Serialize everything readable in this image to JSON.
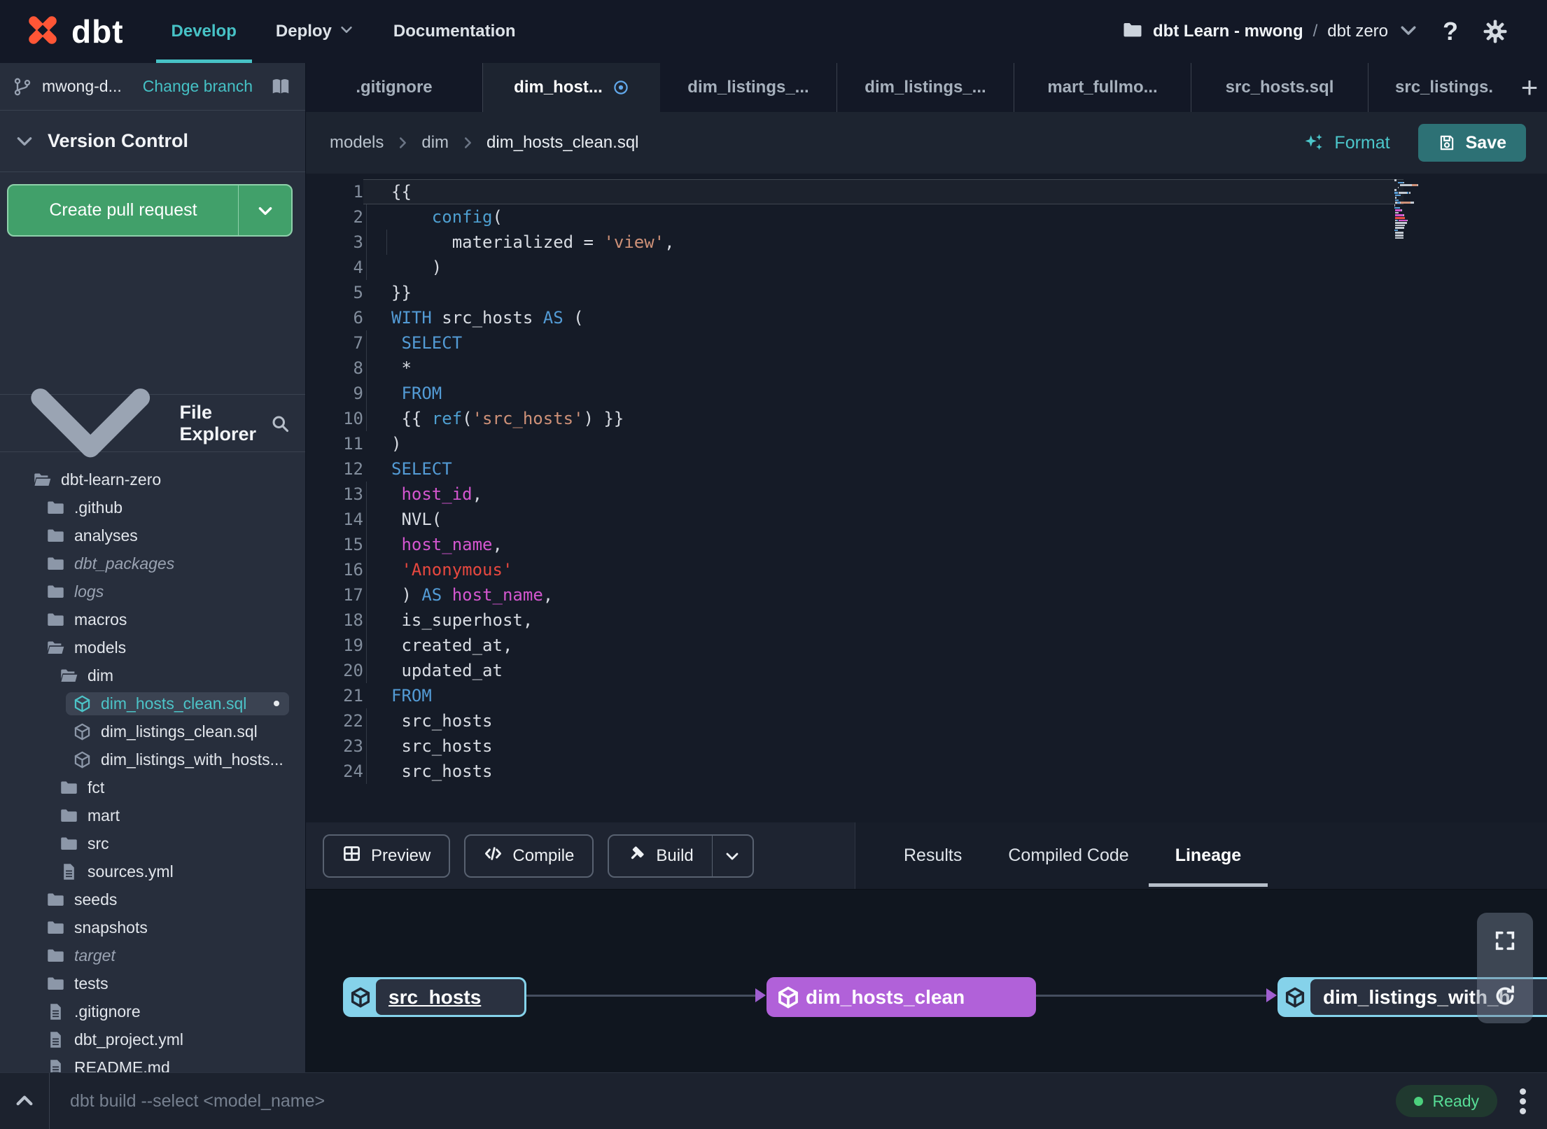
{
  "topbar": {
    "logo_text": "dbt",
    "nav": [
      {
        "label": "Develop",
        "active": true,
        "has_chevron": false
      },
      {
        "label": "Deploy",
        "active": false,
        "has_chevron": true
      },
      {
        "label": "Documentation",
        "active": false,
        "has_chevron": false
      }
    ],
    "account": "dbt Learn - mwong",
    "separator": "/",
    "project": "dbt zero"
  },
  "icons": {
    "help_glyph": "?",
    "plus_glyph": "+"
  },
  "sidebar": {
    "branch": {
      "name": "mwong-d...",
      "change_label": "Change branch"
    },
    "version_control_label": "Version Control",
    "create_pr_label": "Create pull request",
    "file_explorer_label": "File Explorer",
    "tree": [
      {
        "label": "dbt-learn-zero",
        "type": "folder-open",
        "level": 0
      },
      {
        "label": ".github",
        "type": "folder",
        "level": 1
      },
      {
        "label": "analyses",
        "type": "folder",
        "level": 1
      },
      {
        "label": "dbt_packages",
        "type": "folder",
        "level": 1,
        "italic": true
      },
      {
        "label": "logs",
        "type": "folder",
        "level": 1,
        "italic": true
      },
      {
        "label": "macros",
        "type": "folder",
        "level": 1
      },
      {
        "label": "models",
        "type": "folder-open",
        "level": 1
      },
      {
        "label": "dim",
        "type": "folder-open",
        "level": 2
      },
      {
        "label": "dim_hosts_clean.sql",
        "type": "model",
        "level": 3,
        "selected": true,
        "modified": true
      },
      {
        "label": "dim_listings_clean.sql",
        "type": "model",
        "level": 3
      },
      {
        "label": "dim_listings_with_hosts...",
        "type": "model",
        "level": 3
      },
      {
        "label": "fct",
        "type": "folder",
        "level": 2
      },
      {
        "label": "mart",
        "type": "folder",
        "level": 2
      },
      {
        "label": "src",
        "type": "folder",
        "level": 2
      },
      {
        "label": "sources.yml",
        "type": "file",
        "level": 2
      },
      {
        "label": "seeds",
        "type": "folder",
        "level": 1
      },
      {
        "label": "snapshots",
        "type": "folder",
        "level": 1
      },
      {
        "label": "target",
        "type": "folder",
        "level": 1,
        "italic": true
      },
      {
        "label": "tests",
        "type": "folder",
        "level": 1
      },
      {
        "label": ".gitignore",
        "type": "file",
        "level": 1
      },
      {
        "label": "dbt_project.yml",
        "type": "file",
        "level": 1
      },
      {
        "label": "README.md",
        "type": "file",
        "level": 1
      }
    ]
  },
  "tabs": {
    "items": [
      {
        "label": ".gitignore",
        "active": false,
        "dirty": false
      },
      {
        "label": "dim_host...",
        "active": true,
        "dirty": true
      },
      {
        "label": "dim_listings_...",
        "active": false,
        "dirty": false
      },
      {
        "label": "dim_listings_...",
        "active": false,
        "dirty": false
      },
      {
        "label": "mart_fullmo...",
        "active": false,
        "dirty": false
      },
      {
        "label": "src_hosts.sql",
        "active": false,
        "dirty": false
      },
      {
        "label": "src_listings.",
        "active": false,
        "dirty": false
      }
    ]
  },
  "editor_header": {
    "breadcrumb": [
      "models",
      "dim",
      "dim_hosts_clean.sql"
    ],
    "format_label": "Format",
    "save_label": "Save"
  },
  "editor": {
    "lines": [
      {
        "n": 1,
        "cur": true,
        "g": 0,
        "t": [
          [
            "p",
            "{{"
          ]
        ]
      },
      {
        "n": 2,
        "cur": false,
        "g": 1,
        "t": [
          [
            "p",
            "    "
          ],
          [
            "f",
            "config"
          ],
          [
            "p",
            "("
          ]
        ]
      },
      {
        "n": 3,
        "cur": false,
        "g": 2,
        "t": [
          [
            "p",
            "      materialized = "
          ],
          [
            "s",
            "'view'"
          ],
          [
            "p",
            ","
          ]
        ]
      },
      {
        "n": 4,
        "cur": false,
        "g": 1,
        "t": [
          [
            "p",
            "    )"
          ]
        ]
      },
      {
        "n": 5,
        "cur": false,
        "g": 0,
        "t": [
          [
            "p",
            "}}"
          ]
        ]
      },
      {
        "n": 6,
        "cur": false,
        "g": 0,
        "t": [
          [
            "k",
            "WITH"
          ],
          [
            "p",
            " src_hosts "
          ],
          [
            "k",
            "AS"
          ],
          [
            "p",
            " ("
          ]
        ]
      },
      {
        "n": 7,
        "cur": false,
        "g": 1,
        "t": [
          [
            "p",
            " "
          ],
          [
            "k",
            "SELECT"
          ]
        ]
      },
      {
        "n": 8,
        "cur": false,
        "g": 1,
        "t": [
          [
            "p",
            " *"
          ]
        ]
      },
      {
        "n": 9,
        "cur": false,
        "g": 1,
        "t": [
          [
            "p",
            " "
          ],
          [
            "k",
            "FROM"
          ]
        ]
      },
      {
        "n": 10,
        "cur": false,
        "g": 1,
        "t": [
          [
            "p",
            " {{ "
          ],
          [
            "f",
            "ref"
          ],
          [
            "p",
            "("
          ],
          [
            "s",
            "'src_hosts'"
          ],
          [
            "p",
            ") }}"
          ]
        ]
      },
      {
        "n": 11,
        "cur": false,
        "g": 0,
        "t": [
          [
            "p",
            ")"
          ]
        ]
      },
      {
        "n": 12,
        "cur": false,
        "g": 0,
        "t": [
          [
            "k",
            "SELECT"
          ]
        ]
      },
      {
        "n": 13,
        "cur": false,
        "g": 1,
        "t": [
          [
            "p",
            " "
          ],
          [
            "m",
            "host_id"
          ],
          [
            "p",
            ","
          ]
        ]
      },
      {
        "n": 14,
        "cur": false,
        "g": 1,
        "t": [
          [
            "p",
            " NVL("
          ]
        ]
      },
      {
        "n": 15,
        "cur": false,
        "g": 1,
        "t": [
          [
            "p",
            " "
          ],
          [
            "m",
            "host_name"
          ],
          [
            "p",
            ","
          ]
        ]
      },
      {
        "n": 16,
        "cur": false,
        "g": 1,
        "t": [
          [
            "p",
            " "
          ],
          [
            "r",
            "'Anonymous'"
          ]
        ]
      },
      {
        "n": 17,
        "cur": false,
        "g": 1,
        "t": [
          [
            "p",
            " ) "
          ],
          [
            "k",
            "AS"
          ],
          [
            "p",
            " "
          ],
          [
            "m",
            "host_name"
          ],
          [
            "p",
            ","
          ]
        ]
      },
      {
        "n": 18,
        "cur": false,
        "g": 1,
        "t": [
          [
            "p",
            " is_superhost,"
          ]
        ]
      },
      {
        "n": 19,
        "cur": false,
        "g": 1,
        "t": [
          [
            "p",
            " created_at,"
          ]
        ]
      },
      {
        "n": 20,
        "cur": false,
        "g": 1,
        "t": [
          [
            "p",
            " updated_at"
          ]
        ]
      },
      {
        "n": 21,
        "cur": false,
        "g": 0,
        "t": [
          [
            "k",
            "FROM"
          ]
        ]
      },
      {
        "n": 22,
        "cur": false,
        "g": 1,
        "t": [
          [
            "p",
            " src_hosts"
          ]
        ]
      },
      {
        "n": 23,
        "cur": false,
        "g": 1,
        "t": [
          [
            "p",
            " src_hosts"
          ]
        ]
      },
      {
        "n": 24,
        "cur": false,
        "g": 1,
        "t": [
          [
            "p",
            " src_hosts"
          ]
        ]
      }
    ]
  },
  "panel": {
    "buttons": [
      {
        "label": "Preview",
        "icon": "table",
        "split": false
      },
      {
        "label": "Compile",
        "icon": "code",
        "split": false
      },
      {
        "label": "Build",
        "icon": "hammer",
        "split": true
      }
    ],
    "tabs": [
      {
        "label": "Results",
        "active": false
      },
      {
        "label": "Compiled Code",
        "active": false
      },
      {
        "label": "Lineage",
        "active": true
      }
    ]
  },
  "lineage": {
    "nodes": [
      {
        "label": "src_hosts",
        "style": "source",
        "underline": true
      },
      {
        "label": "dim_hosts_clean",
        "style": "selected",
        "underline": false
      },
      {
        "label": "dim_listings_with_h",
        "style": "source",
        "underline": false
      }
    ]
  },
  "command_bar": {
    "command": "dbt build --select <model_name>",
    "status": "Ready"
  },
  "colors": {
    "accent_teal": "#47c2c6",
    "pr_green": "#41a06a",
    "save_teal": "#2d7175",
    "node_cyan": "#85d2ea",
    "node_purple": "#b161d9",
    "status_green": "#57dd96",
    "logo_orange": "#ff5636",
    "code_keyword": "#539bd5",
    "code_string": "#ce9178",
    "code_string_red": "#e8483f",
    "code_ident": "#d456cf"
  }
}
